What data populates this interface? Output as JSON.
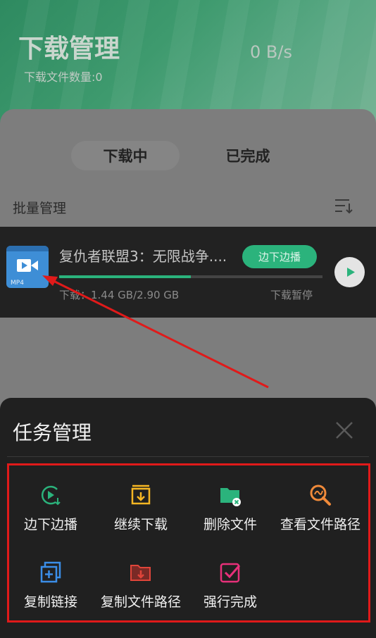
{
  "header": {
    "title": "下载管理",
    "file_count": "下载文件数量:0",
    "speed": "0 B/s"
  },
  "tabs": [
    {
      "label": "下载中",
      "active": true
    },
    {
      "label": "已完成",
      "active": false
    }
  ],
  "batch_label": "批量管理",
  "download_item": {
    "title": "复仇者联盟3：无限战争....",
    "thumb_label": "MP4",
    "play_label": "边下边播",
    "size": "下载：1.44 GB/2.90 GB",
    "status": "下载暂停",
    "progress": 0.5
  },
  "sheet": {
    "title": "任务管理",
    "actions": [
      {
        "label": "边下边播",
        "icon": "play-download-icon",
        "color": "#2bb37c"
      },
      {
        "label": "继续下载",
        "icon": "resume-download-icon",
        "color": "#f5b623"
      },
      {
        "label": "删除文件",
        "icon": "delete-folder-icon",
        "color": "#2bb37c"
      },
      {
        "label": "查看文件路径",
        "icon": "search-path-icon",
        "color": "#f08a3a"
      },
      {
        "label": "复制链接",
        "icon": "copy-link-icon",
        "color": "#3b8ee8"
      },
      {
        "label": "复制文件路径",
        "icon": "copy-path-icon",
        "color": "#e0453a"
      },
      {
        "label": "强行完成",
        "icon": "force-complete-icon",
        "color": "#e8307a"
      }
    ]
  },
  "colors": {
    "accent": "#2bb37c",
    "highlight_box": "#e01a1a",
    "sheet_bg": "#202020"
  }
}
